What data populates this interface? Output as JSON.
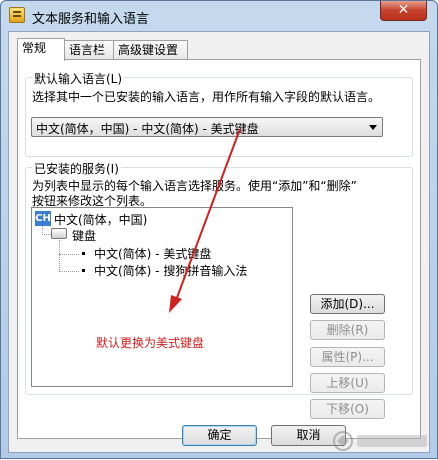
{
  "window": {
    "title": "文本服务和输入语言",
    "close_label": "✕"
  },
  "tabs": [
    {
      "label": "常规",
      "active": true
    },
    {
      "label": "语言栏",
      "active": false
    },
    {
      "label": "高级键设置",
      "active": false
    }
  ],
  "default_language": {
    "group_title": "默认输入语言(L)",
    "description": "选择其中一个已安装的输入语言，用作所有输入字段的默认语言。",
    "selected": "中文(简体，中国) - 中文(简体) - 美式键盘"
  },
  "installed_services": {
    "group_title": "已安装的服务(I)",
    "description_line1": "为列表中显示的每个输入语言选择服务。使用“添加”和“删除”",
    "description_line2": "按钮来修改这个列表。",
    "tree": {
      "language": "中文(简体，中国)",
      "language_icon": "CH",
      "category": "键盘",
      "services": [
        "中文(简体) - 美式键盘",
        "中文(简体) - 搜狗拼音输入法"
      ]
    },
    "buttons": {
      "add": "添加(D)...",
      "remove": "删除(R)",
      "properties": "属性(P)...",
      "move_up": "上移(U)",
      "move_down": "下移(O)"
    }
  },
  "annotation": "默认更换为美式键盘",
  "footer": {
    "ok": "确定",
    "cancel": "取消"
  },
  "colors": {
    "annotation": "#d02020",
    "title_bar": "#c5d8ee"
  }
}
